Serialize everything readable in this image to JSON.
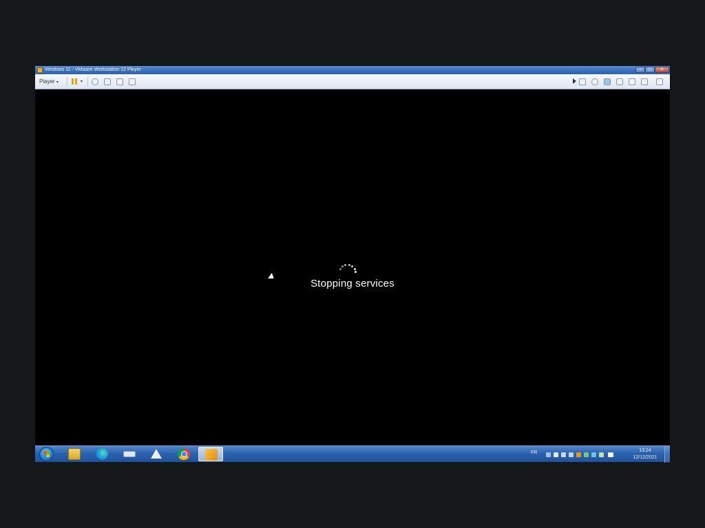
{
  "window": {
    "title": "Windows 11 - VMware Workstation 12 Player",
    "minimize_glyph": "–",
    "maximize_glyph": "□",
    "close_glyph": "✕"
  },
  "toolbar": {
    "player_label": "Player",
    "player_caret": "▾",
    "pause_caret": "▾",
    "icons": [
      "send-ctrl-alt-del-icon",
      "removable-devices-icon",
      "full-screen-icon",
      "unity-icon"
    ],
    "right_icons": [
      "hard-disk-icon",
      "cd-drive-icon",
      "network-icon",
      "usb-icon",
      "sound-icon",
      "printer-icon",
      "display-icon"
    ]
  },
  "vm": {
    "status_text": "Stopping services",
    "background_color": "#000000"
  },
  "taskbar": {
    "apps": [
      {
        "name": "file-explorer-icon"
      },
      {
        "name": "edge-icon"
      },
      {
        "name": "device-icon"
      },
      {
        "name": "unity-icon"
      },
      {
        "name": "chrome-icon"
      },
      {
        "name": "vmware-player-icon",
        "active": true
      }
    ],
    "language": "FR",
    "time": "13:24",
    "date": "12/12/2021"
  },
  "colors": {
    "taskbar": "#2c63ad",
    "titlebar": "#3a6fb9",
    "letterbox": "#161718"
  }
}
